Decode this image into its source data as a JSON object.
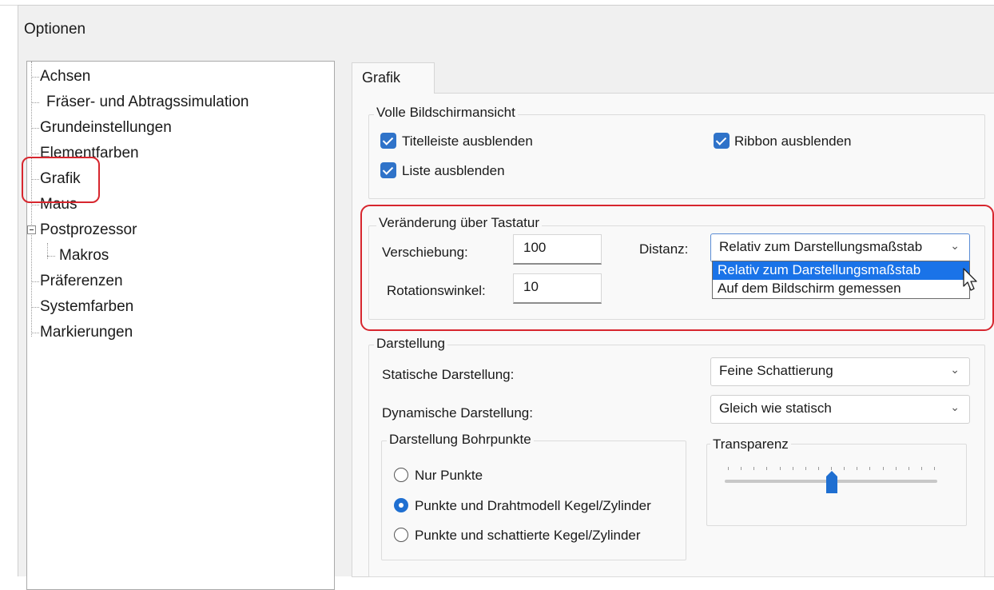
{
  "window": {
    "title": "Optionen"
  },
  "tree": {
    "items": [
      {
        "label": "Achsen"
      },
      {
        "label": "Fräser- und Abtragssimulation"
      },
      {
        "label": "Grundeinstellungen"
      },
      {
        "label": "Elementfarben"
      },
      {
        "label": "Grafik"
      },
      {
        "label": "Maus"
      },
      {
        "label": "Postprozessor"
      },
      {
        "label": "Makros"
      },
      {
        "label": "Präferenzen"
      },
      {
        "label": "Systemfarben"
      },
      {
        "label": "Markierungen"
      }
    ]
  },
  "tabs": [
    {
      "label": "Grafik"
    }
  ],
  "full_screen": {
    "title": "Volle Bildschirmansicht",
    "hide_title_bar": {
      "label": "Titelleiste ausblenden",
      "checked": true
    },
    "hide_ribbon": {
      "label": "Ribbon ausblenden",
      "checked": true
    },
    "hide_list": {
      "label": "Liste ausblenden",
      "checked": true
    }
  },
  "keyboard": {
    "title": "Veränderung über Tastatur",
    "shift_label": "Verschiebung:",
    "shift_value": "100",
    "rotation_label": "Rotationswinkel:",
    "rotation_value": "10",
    "distance_label": "Distanz:",
    "distance_value": "Relativ zum Darstellungsmaßstab",
    "distance_options": [
      "Relativ zum Darstellungsmaßstab",
      "Auf dem Bildschirm gemessen"
    ],
    "distance_selected_index": 0
  },
  "display": {
    "title": "Darstellung",
    "static_label": "Statische Darstellung:",
    "static_value": "Feine Schattierung",
    "dynamic_label": "Dynamische Darstellung:",
    "dynamic_value": "Gleich wie statisch",
    "drill": {
      "title": "Darstellung Bohrpunkte",
      "options": [
        "Nur Punkte",
        "Punkte und Drahtmodell Kegel/Zylinder",
        "Punkte und schattierte Kegel/Zylinder"
      ],
      "selected_index": 1
    },
    "transparency": {
      "title": "Transparenz",
      "level_fraction": 0.5
    }
  },
  "colors": {
    "accent": "#2f73c9",
    "highlight_red": "#d7262e",
    "selection": "#1a73e8"
  },
  "icons": {
    "chevron": "chevron-down-icon",
    "cursor": "mouse-pointer-icon"
  }
}
